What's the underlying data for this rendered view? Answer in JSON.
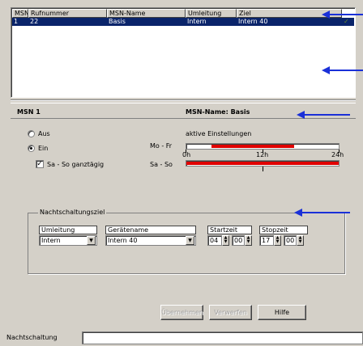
{
  "list": {
    "headers": [
      "MSN",
      "Rufnummer",
      "MSN-Name",
      "Umleitung",
      "Ziel"
    ],
    "rows": [
      {
        "msn": "1",
        "rufnummer": "22",
        "name": "Basis",
        "umleitung": "Intern",
        "ziel": "Intern 40",
        "active": true
      }
    ]
  },
  "panel": {
    "title_left": "MSN 1",
    "title_right": "MSN-Name: Basis"
  },
  "mode": {
    "off_label": "Aus",
    "on_label": "Ein",
    "selected": "Ein",
    "weekend_allday_label": "Sa - So ganztägig",
    "weekend_allday_checked": true
  },
  "schedule": {
    "caption": "aktive Einstellungen",
    "weekday_label": "Mo - Fr",
    "weekend_label": "Sa - So",
    "axis": [
      "0h",
      "12h",
      "24h"
    ],
    "weekday_active_fraction": [
      0.167,
      0.708
    ],
    "weekend_active_fraction": [
      0.0,
      1.0
    ]
  },
  "night_target": {
    "group_label": "Nachtschaltungsziel",
    "headers": [
      "Umleitung",
      "Gerätename",
      "Startzeit",
      "Stopzeit"
    ],
    "umleitung": "Intern",
    "device": "Intern 40",
    "start_hour": "04",
    "start_min": "00",
    "stop_hour": "17",
    "stop_min": "00"
  },
  "buttons": {
    "apply": "Übernehmen",
    "discard": "Verwerfen",
    "help": "Hilfe"
  },
  "status": {
    "label": "Nachtschaltung",
    "value": ""
  },
  "colors": {
    "selection": "#0a246a",
    "schedule_fill": "#e00000",
    "annotation_arrow": "#1a30d8"
  }
}
